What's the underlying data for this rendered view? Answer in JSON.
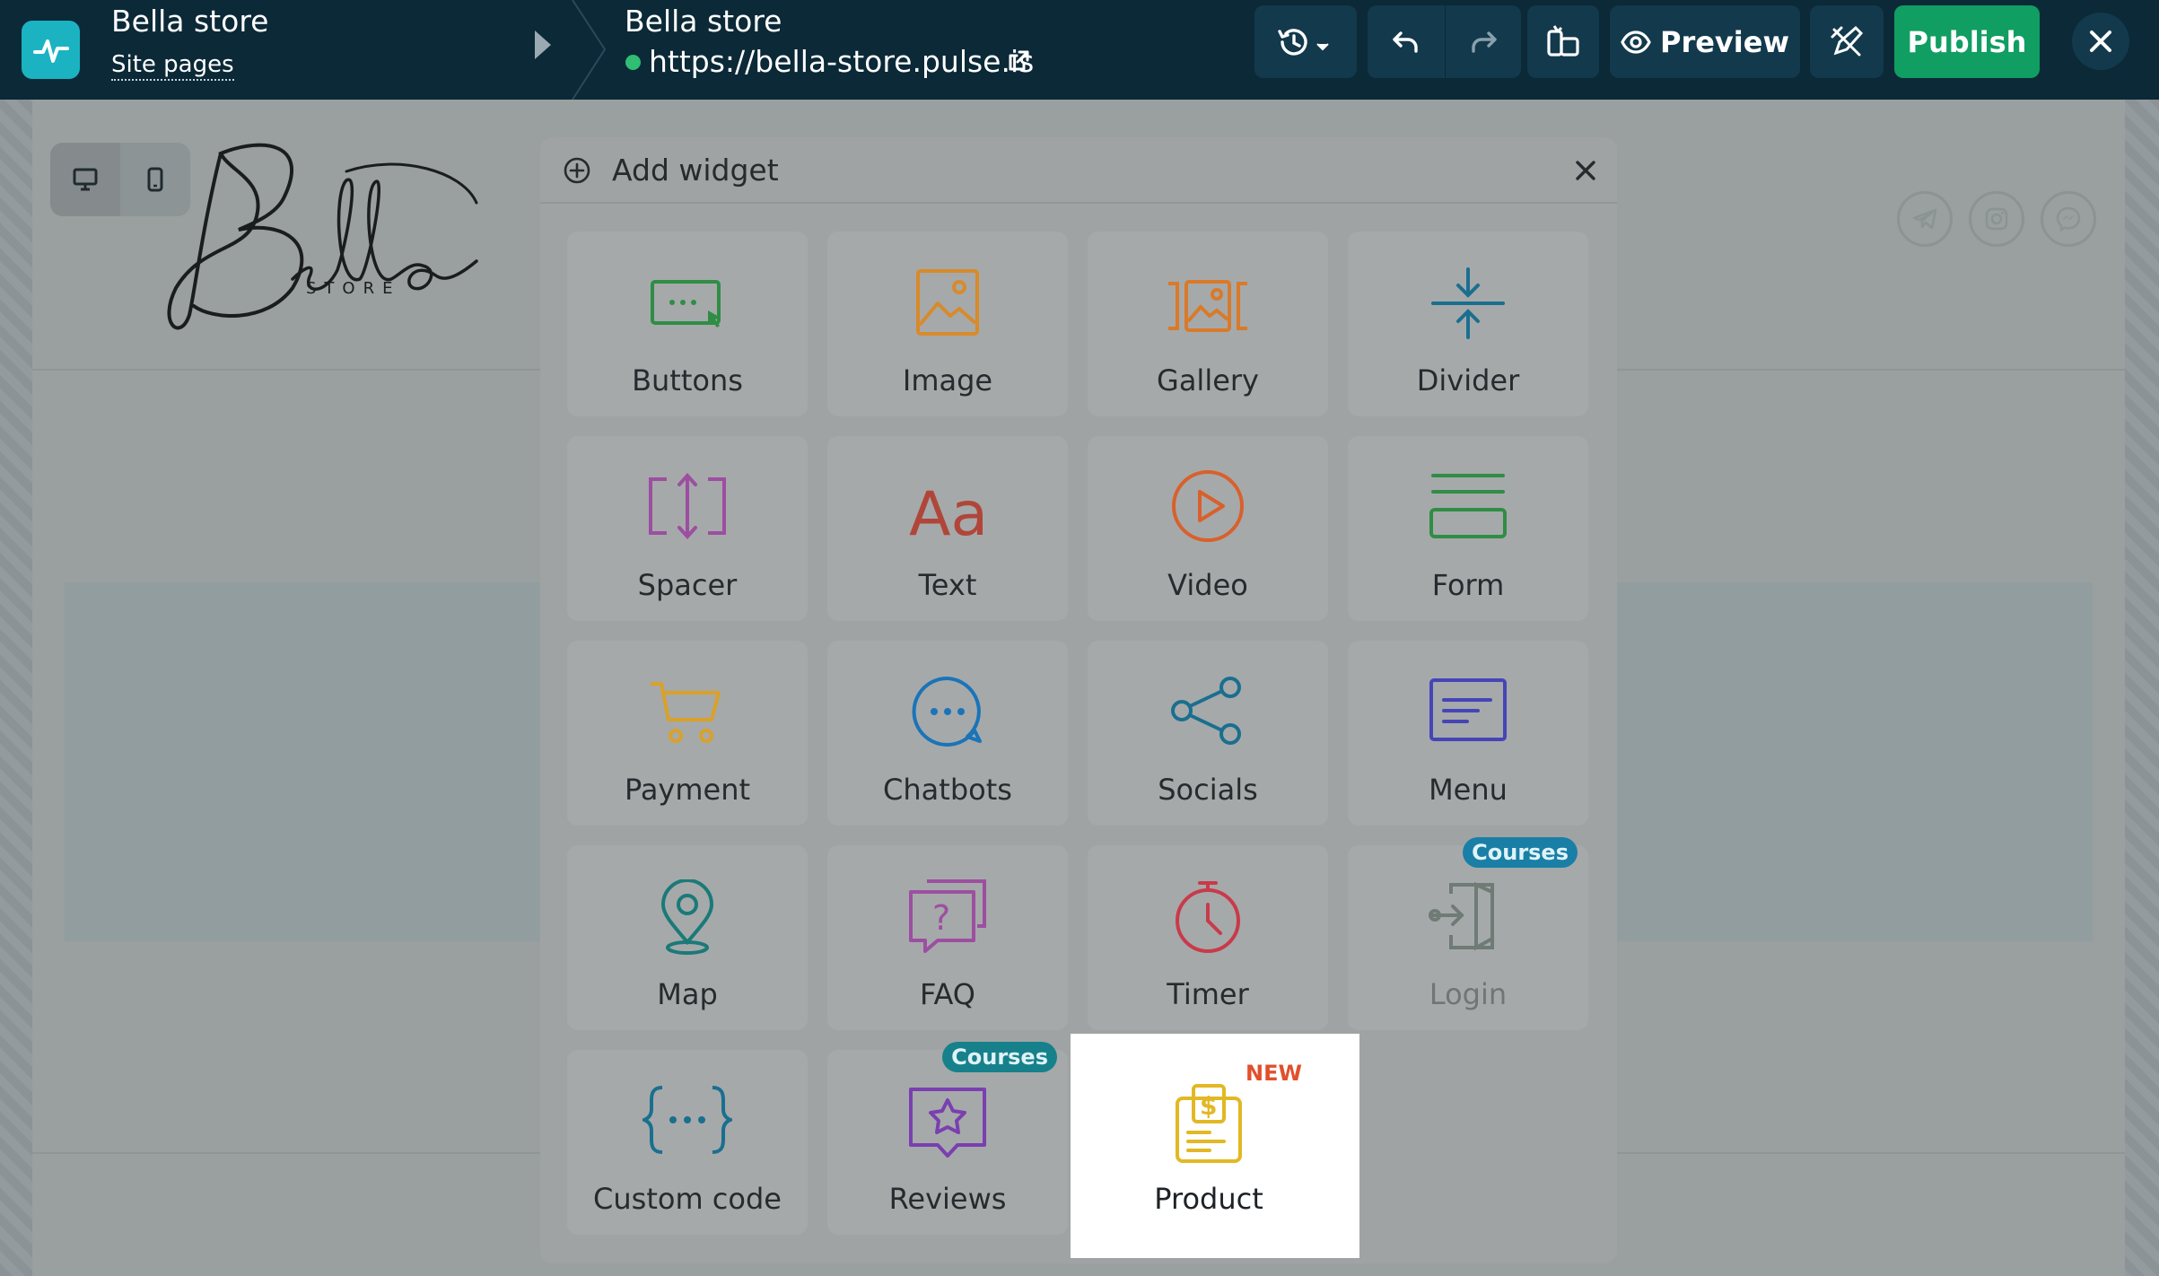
{
  "app": {
    "site_name": "Bella store",
    "site_pages_link": "Site pages",
    "page_name": "Bella store",
    "page_url": "https://bella-store.pulse.is",
    "status_color": "#2fbe72",
    "accent_color": "#109e62"
  },
  "toolbar": {
    "history_icon": "history-icon",
    "undo_icon": "undo-icon",
    "redo_icon": "redo-icon",
    "pages_icon": "pages-icon",
    "preview_label": "Preview",
    "design_icon": "design-icon",
    "publish_label": "Publish",
    "close_icon": "close-icon"
  },
  "canvas": {
    "brand_logo_text": "Bella",
    "brand_logo_sub": "STORE",
    "devices": [
      "desktop",
      "mobile"
    ],
    "active_device": "desktop",
    "socials": [
      "telegram",
      "instagram",
      "messenger"
    ]
  },
  "widget_modal": {
    "title": "Add widget",
    "close_icon": "close-icon",
    "widgets": [
      {
        "label": "Buttons",
        "icon": "buttons-icon",
        "color": "#2f8d45"
      },
      {
        "label": "Image",
        "icon": "image-icon",
        "color": "#d98a2a"
      },
      {
        "label": "Gallery",
        "icon": "gallery-icon",
        "color": "#d97a2a"
      },
      {
        "label": "Divider",
        "icon": "divider-icon",
        "color": "#1a6f8f"
      },
      {
        "label": "Spacer",
        "icon": "spacer-icon",
        "color": "#9c4fa1"
      },
      {
        "label": "Text",
        "icon": "text-icon",
        "color": "#b0463a"
      },
      {
        "label": "Video",
        "icon": "video-icon",
        "color": "#d9602a"
      },
      {
        "label": "Form",
        "icon": "form-icon",
        "color": "#2f8d45"
      },
      {
        "label": "Payment",
        "icon": "payment-icon",
        "color": "#d9a12a"
      },
      {
        "label": "Chatbots",
        "icon": "chatbots-icon",
        "color": "#1a74b8"
      },
      {
        "label": "Socials",
        "icon": "socials-icon",
        "color": "#1a6f8f"
      },
      {
        "label": "Menu",
        "icon": "menu-icon",
        "color": "#4545b8"
      },
      {
        "label": "Map",
        "icon": "map-icon",
        "color": "#1a7a78"
      },
      {
        "label": "FAQ",
        "icon": "faq-icon",
        "color": "#9c4fa1"
      },
      {
        "label": "Timer",
        "icon": "timer-icon",
        "color": "#c93a4a"
      },
      {
        "label": "Login",
        "icon": "login-icon",
        "color": "#6f7b75",
        "badge": "Courses"
      },
      {
        "label": "Custom code",
        "icon": "custom-code-icon",
        "color": "#1a6f8f"
      },
      {
        "label": "Reviews",
        "icon": "reviews-icon",
        "color": "#7a3fb0",
        "badge": "Courses"
      },
      {
        "label": "Product",
        "icon": "product-icon",
        "color": "#e2b824",
        "badge": "NEW"
      }
    ]
  }
}
